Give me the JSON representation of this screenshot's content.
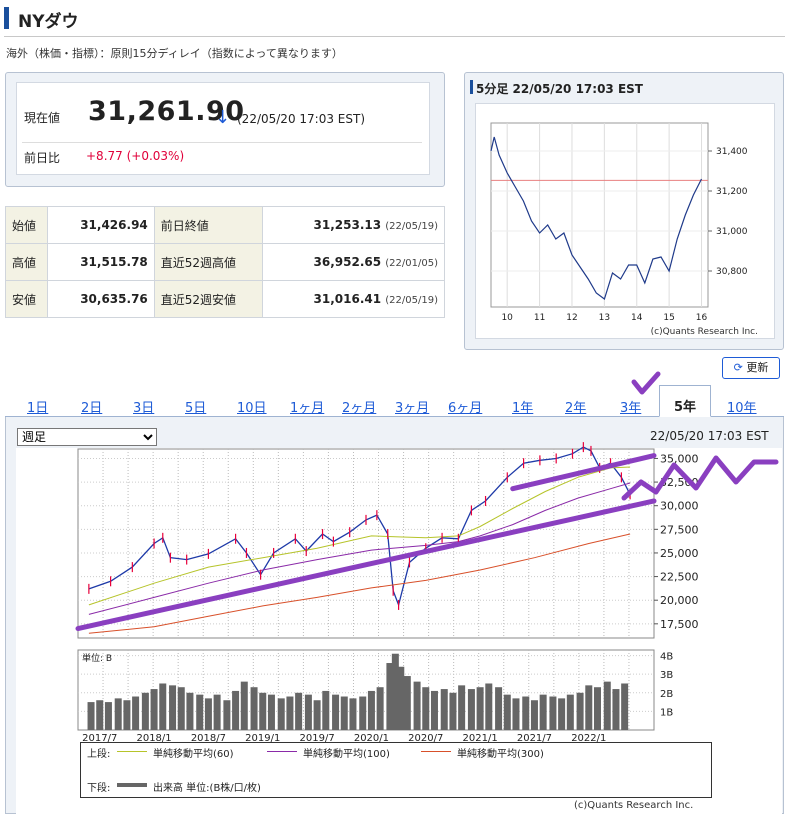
{
  "header": {
    "title": "NYダウ",
    "note": "海外（株価・指標）：原則15分ディレイ（指数によって異なります）"
  },
  "quote": {
    "current_label": "現在値",
    "current_value": "31,261.90",
    "direction_arrow": "↓",
    "timestamp": "(22/05/20 17:03 EST)",
    "change_label": "前日比",
    "change_value": "+8.77 (+0.03%)",
    "change_color": "#e0003a"
  },
  "ohlc": {
    "open_label": "始値",
    "open": "31,426.94",
    "prev_close_label": "前日終値",
    "prev_close": "31,253.13",
    "prev_close_date": "(22/05/19)",
    "high_label": "高値",
    "high": "31,515.78",
    "high52_label": "直近52週高値",
    "high52": "36,952.65",
    "high52_date": "(22/01/05)",
    "low_label": "安値",
    "low": "30,635.76",
    "low52_label": "直近52週安値",
    "low52": "31,016.41",
    "low52_date": "(22/05/19)"
  },
  "mini_chart": {
    "title": "5分足 22/05/20 17:03 EST",
    "credit": "(c)Quants Research Inc."
  },
  "refresh_label": "更新",
  "tabs": [
    "1日",
    "2日",
    "3日",
    "5日",
    "10日",
    "1ヶ月",
    "2ヶ月",
    "3ヶ月",
    "6ヶ月",
    "1年",
    "2年",
    "3年",
    "5年",
    "10年"
  ],
  "active_tab": "5年",
  "main_chart": {
    "period_options": [
      "週足"
    ],
    "period_selected": "週足",
    "timestamp": "22/05/20 17:03 EST",
    "volume_unit": "単位: B",
    "legend": {
      "upper_label": "上段:",
      "ma60": "単純移動平均(60)",
      "ma100": "単純移動平均(100)",
      "ma300": "単純移動平均(300)",
      "lower_label": "下段:",
      "volume": "出来高 単位:(B株/口/枚)"
    },
    "colors": {
      "price_up": "#e8003a",
      "price_down": "#1e3aa8",
      "ma60": "#b6c42a",
      "ma100": "#8a2aa8",
      "ma300": "#d8502a",
      "volume": "#666666",
      "annotation": "#8a3fc0"
    },
    "credit": "(c)Quants Research Inc."
  },
  "chart_data": [
    {
      "type": "line",
      "title": "5分足 22/05/20 17:03 EST",
      "x_ticks": [
        "10",
        "11",
        "12",
        "13",
        "14",
        "15",
        "16"
      ],
      "y_ticks": [
        "31,400",
        "31,200",
        "31,000",
        "30,800"
      ],
      "ylim": [
        30620,
        31540
      ],
      "reference_line": 31253.13,
      "reference_color": "#e88080",
      "line_color": "#1f3a8a",
      "series": [
        {
          "x": [
            9.5,
            9.6,
            9.75,
            10.0,
            10.25,
            10.5,
            10.75,
            11.0,
            11.25,
            11.5,
            11.75,
            12.0,
            12.25,
            12.5,
            12.75,
            13.0,
            13.25,
            13.5,
            13.75,
            14.0,
            14.25,
            14.5,
            14.75,
            15.0,
            15.25,
            15.5,
            15.75,
            16.0
          ],
          "y": [
            31400,
            31470,
            31380,
            31290,
            31220,
            31150,
            31050,
            30990,
            31030,
            30960,
            30990,
            30880,
            30820,
            30760,
            30690,
            30660,
            30790,
            30760,
            30830,
            30830,
            30740,
            30860,
            30870,
            30800,
            30960,
            31080,
            31180,
            31260
          ]
        }
      ]
    },
    {
      "type": "line",
      "title": "",
      "x_ticks": [
        "2017/7",
        "2018/1",
        "2018/7",
        "2019/1",
        "2019/7",
        "2020/1",
        "2020/7",
        "2021/1",
        "2021/7",
        "2022/1"
      ],
      "y_ticks": [
        "35,000",
        "32,500",
        "30,000",
        "27,500",
        "25,000",
        "22,500",
        "20,000",
        "17,500"
      ],
      "ylim": [
        16000,
        36000
      ],
      "xlim": [
        2017.3,
        2022.6
      ],
      "series": [
        {
          "name": "週足",
          "x": [
            2017.4,
            2017.6,
            2017.8,
            2018.0,
            2018.08,
            2018.15,
            2018.3,
            2018.5,
            2018.75,
            2018.85,
            2018.98,
            2019.1,
            2019.3,
            2019.4,
            2019.55,
            2019.65,
            2019.8,
            2019.95,
            2020.05,
            2020.15,
            2020.2,
            2020.25,
            2020.35,
            2020.5,
            2020.65,
            2020.8,
            2020.92,
            2021.05,
            2021.25,
            2021.4,
            2021.55,
            2021.7,
            2021.85,
            2021.95,
            2022.02,
            2022.1,
            2022.2,
            2022.3,
            2022.38
          ],
          "y": [
            21200,
            22000,
            23500,
            26000,
            26600,
            24500,
            24300,
            24900,
            26500,
            25000,
            22700,
            25000,
            26500,
            25200,
            27000,
            26200,
            27200,
            28500,
            29000,
            27000,
            21000,
            19500,
            24000,
            25500,
            26600,
            26500,
            29500,
            30500,
            33000,
            34500,
            34800,
            35000,
            35500,
            36200,
            35800,
            34000,
            34500,
            33000,
            31200
          ]
        },
        {
          "name": "単純移動平均(60)",
          "x": [
            2017.4,
            2018.0,
            2018.5,
            2019.0,
            2019.5,
            2020.0,
            2020.25,
            2020.5,
            2020.8,
            2021.0,
            2021.3,
            2021.6,
            2021.9,
            2022.2,
            2022.38
          ],
          "y": [
            19500,
            21800,
            23500,
            24500,
            25500,
            26800,
            26700,
            26600,
            26800,
            27800,
            29700,
            31500,
            33000,
            34000,
            34100
          ]
        },
        {
          "name": "単純移動平均(100)",
          "x": [
            2017.4,
            2018.0,
            2018.5,
            2019.0,
            2019.5,
            2020.0,
            2020.5,
            2020.8,
            2021.0,
            2021.3,
            2021.6,
            2021.9,
            2022.2,
            2022.38
          ],
          "y": [
            18500,
            20300,
            21800,
            23200,
            24300,
            25300,
            25800,
            26200,
            26800,
            28000,
            29500,
            30800,
            31800,
            32400
          ]
        },
        {
          "name": "単純移動平均(300)",
          "x": [
            2017.4,
            2018.0,
            2018.5,
            2019.0,
            2019.5,
            2020.0,
            2020.5,
            2021.0,
            2021.5,
            2022.0,
            2022.38
          ],
          "y": [
            16500,
            17200,
            18300,
            19400,
            20300,
            21300,
            22100,
            23200,
            24500,
            26000,
            27000
          ]
        }
      ],
      "annotations": [
        {
          "type": "trendline",
          "from": [
            2017.3,
            17000
          ],
          "to": [
            2022.6,
            30500
          ]
        },
        {
          "type": "trendline",
          "from": [
            2021.3,
            31800
          ],
          "to": [
            2022.6,
            35300
          ]
        },
        {
          "type": "checkmark",
          "near_tab": "3年"
        },
        {
          "type": "zigzag",
          "position": "right"
        }
      ]
    },
    {
      "type": "bar",
      "title": "",
      "ylabel": "単位: B",
      "y_ticks": [
        "4B",
        "3B",
        "2B",
        "1B"
      ],
      "ylim": [
        0,
        4.3
      ],
      "x_ticks": [
        "2017/7",
        "2018/1",
        "2018/7",
        "2019/1",
        "2019/7",
        "2020/1",
        "2020/7",
        "2021/1",
        "2021/7",
        "2022/1"
      ],
      "xlim": [
        2017.3,
        2022.6
      ],
      "series": [
        {
          "name": "出来高 単位:(B株/口/枚)",
          "x": [
            2017.42,
            2017.5,
            2017.58,
            2017.67,
            2017.75,
            2017.83,
            2017.92,
            2018.0,
            2018.08,
            2018.17,
            2018.25,
            2018.33,
            2018.42,
            2018.5,
            2018.58,
            2018.67,
            2018.75,
            2018.83,
            2018.92,
            2019.0,
            2019.08,
            2019.17,
            2019.25,
            2019.33,
            2019.42,
            2019.5,
            2019.58,
            2019.67,
            2019.75,
            2019.83,
            2019.92,
            2020.0,
            2020.08,
            2020.17,
            2020.22,
            2020.27,
            2020.33,
            2020.42,
            2020.5,
            2020.58,
            2020.67,
            2020.75,
            2020.83,
            2020.92,
            2021.0,
            2021.08,
            2021.17,
            2021.25,
            2021.33,
            2021.42,
            2021.5,
            2021.58,
            2021.67,
            2021.75,
            2021.83,
            2021.92,
            2022.0,
            2022.08,
            2022.17,
            2022.25,
            2022.33
          ],
          "y": [
            1.5,
            1.6,
            1.5,
            1.7,
            1.6,
            1.8,
            2.0,
            2.2,
            2.5,
            2.4,
            2.3,
            2.0,
            1.9,
            1.7,
            1.9,
            1.6,
            2.1,
            2.6,
            2.3,
            2.0,
            1.9,
            1.7,
            1.8,
            2.0,
            1.9,
            1.6,
            2.1,
            1.9,
            1.8,
            1.7,
            1.8,
            2.1,
            2.3,
            3.6,
            4.1,
            3.4,
            2.9,
            2.6,
            2.3,
            2.1,
            2.2,
            2.0,
            2.4,
            2.2,
            2.3,
            2.5,
            2.3,
            1.9,
            1.7,
            1.8,
            1.6,
            1.9,
            1.8,
            1.7,
            1.9,
            2.0,
            2.4,
            2.3,
            2.6,
            2.2,
            2.5
          ]
        }
      ]
    }
  ]
}
